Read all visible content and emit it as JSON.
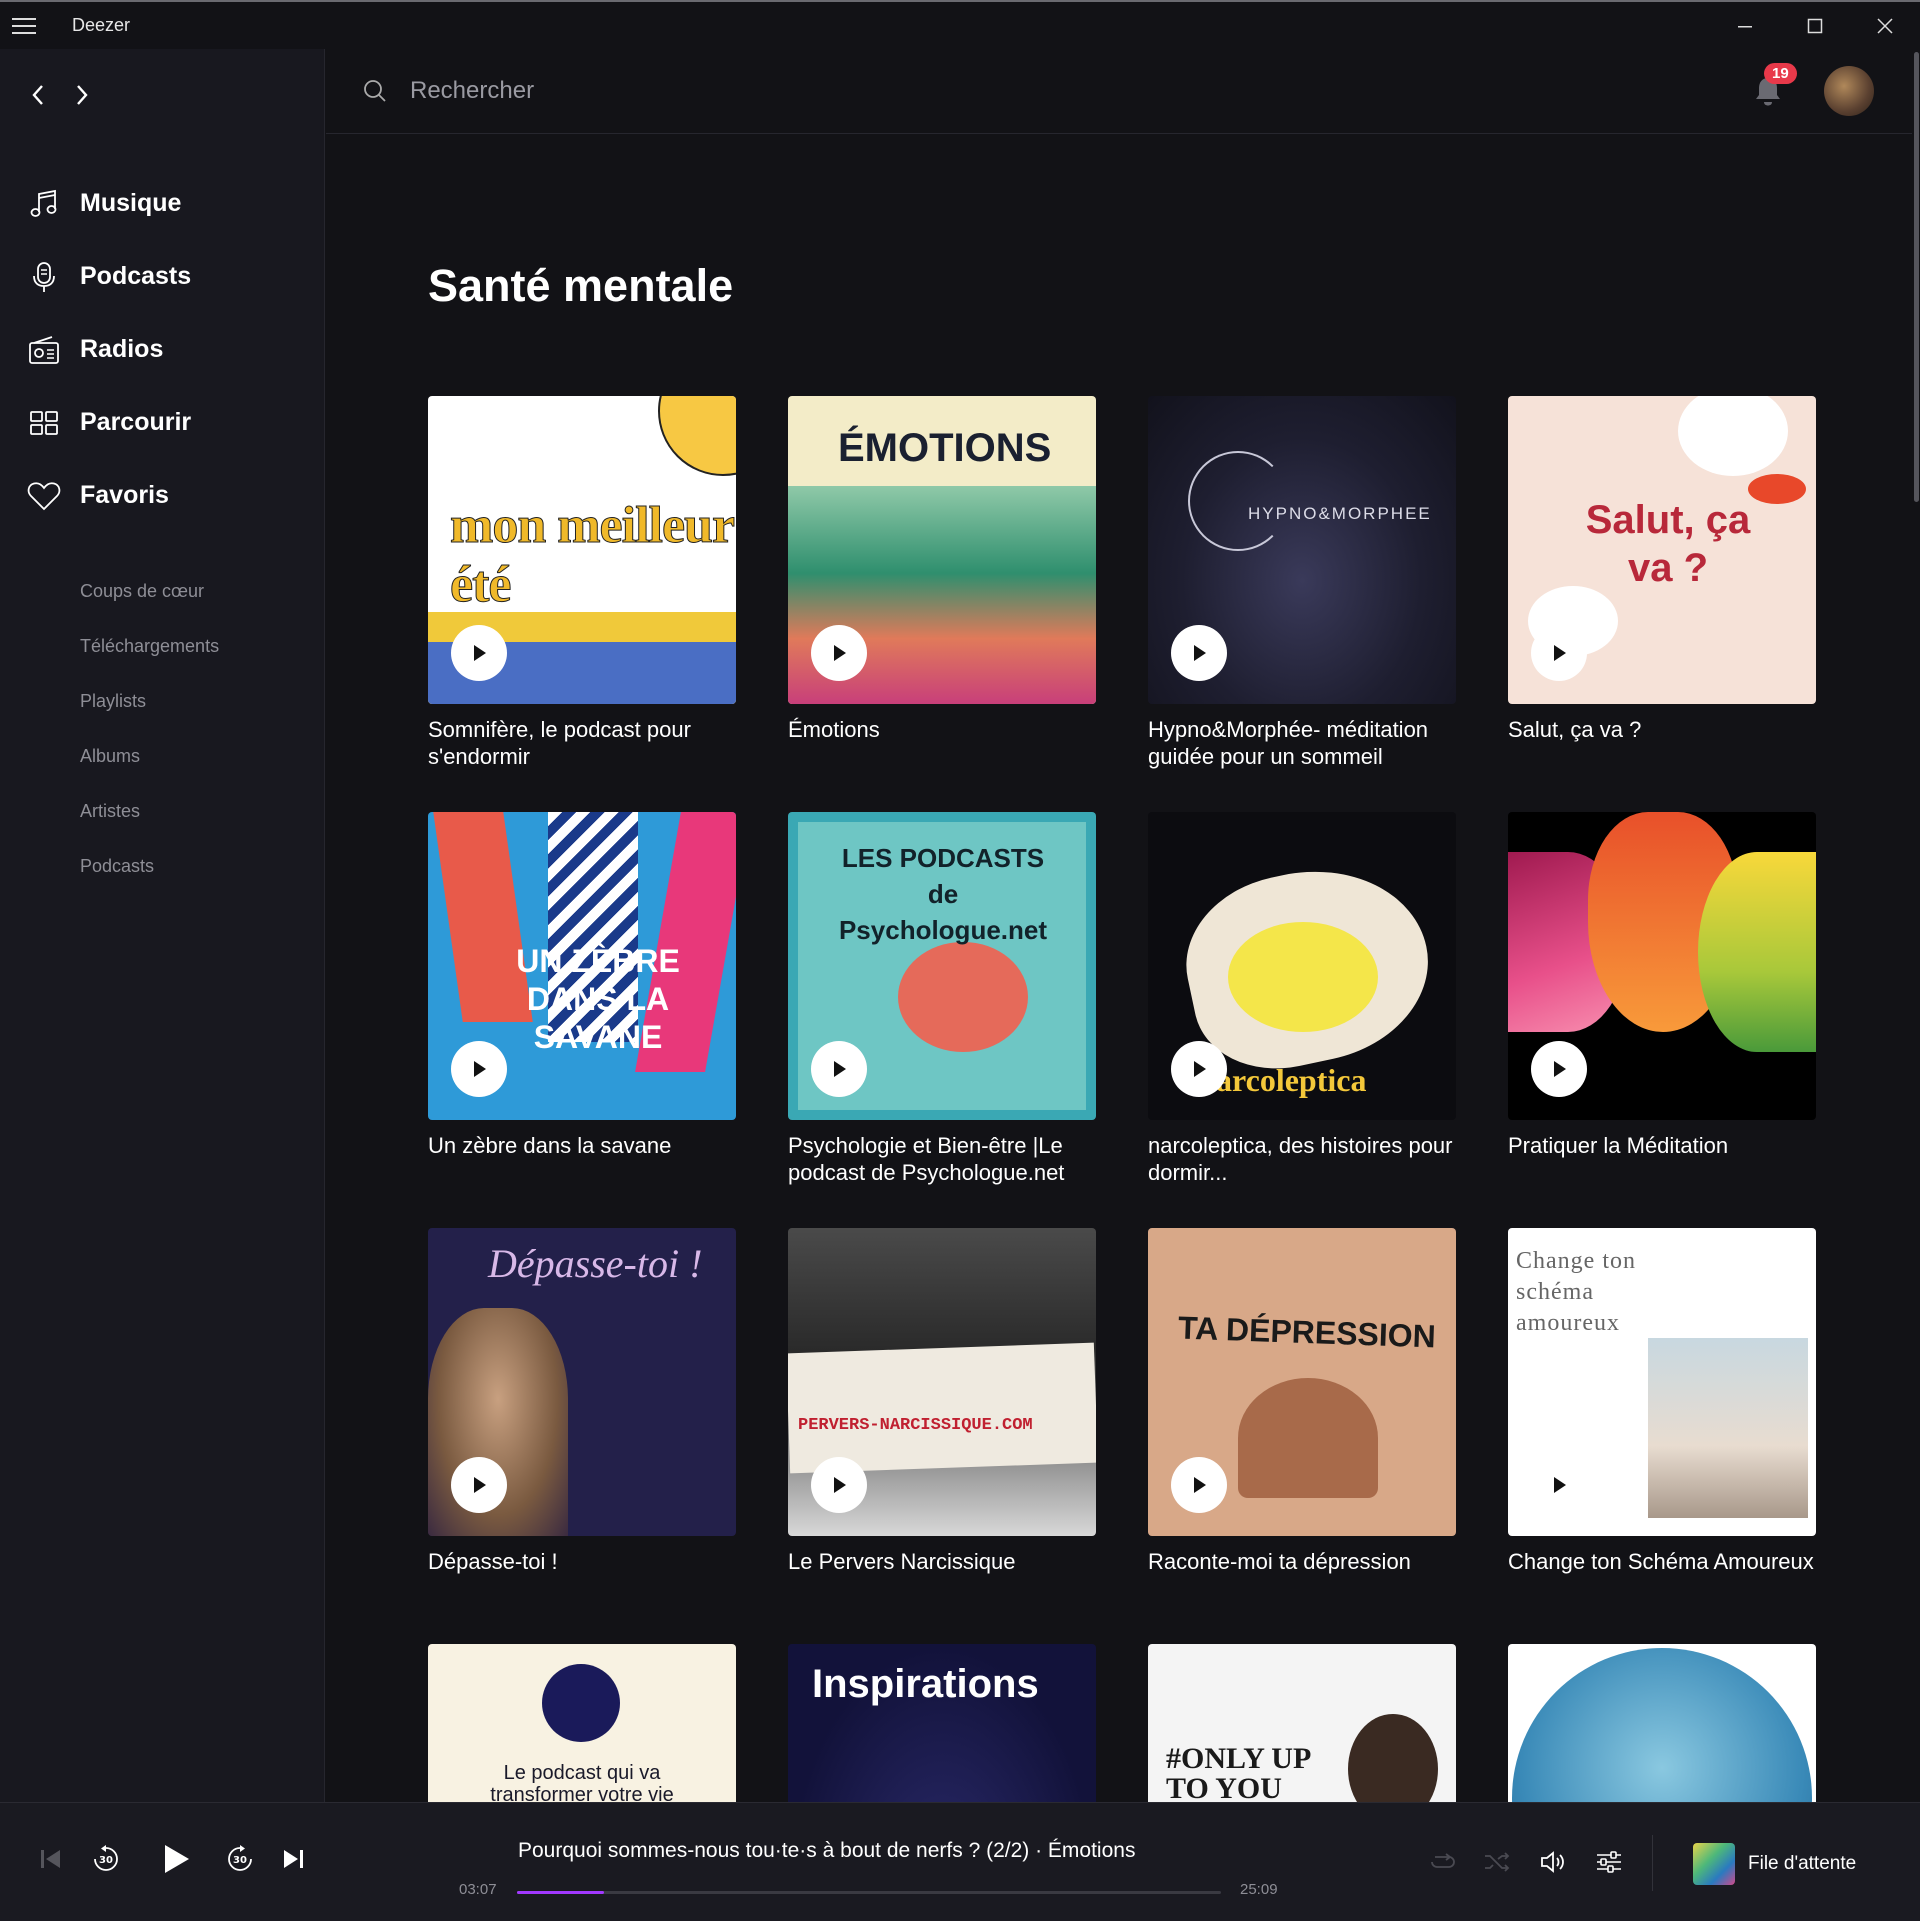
{
  "window": {
    "title": "Deezer"
  },
  "search": {
    "placeholder": "Rechercher"
  },
  "notifications": {
    "count": "19"
  },
  "sidebar": {
    "main": [
      {
        "label": "Musique",
        "icon": "music-note-icon"
      },
      {
        "label": "Podcasts",
        "icon": "microphone-icon"
      },
      {
        "label": "Radios",
        "icon": "radio-icon"
      },
      {
        "label": "Parcourir",
        "icon": "grid-icon"
      },
      {
        "label": "Favoris",
        "icon": "heart-icon"
      }
    ],
    "sub": [
      {
        "label": "Coups de cœur"
      },
      {
        "label": "Téléchargements"
      },
      {
        "label": "Playlists"
      },
      {
        "label": "Albums"
      },
      {
        "label": "Artistes"
      },
      {
        "label": "Podcasts"
      }
    ]
  },
  "page": {
    "title": "Santé mentale"
  },
  "cards": [
    {
      "title": "Somnifère, le podcast pour s'endormir",
      "cover_text": "mon meilleur été"
    },
    {
      "title": "Émotions",
      "cover_text": "ÉMOTIONS"
    },
    {
      "title": "Hypno&Morphée- méditation guidée pour un sommeil",
      "cover_text": "HYPNO&MORPHEE"
    },
    {
      "title": "Salut, ça va ?",
      "cover_text": "Salut, ça va ?"
    },
    {
      "title": "Un zèbre dans la savane",
      "cover_text": "UN ZÈBRE DANS LA SAVANE"
    },
    {
      "title": "Psychologie et Bien-être |Le podcast de Psychologue.net",
      "cover_text": "LES PODCASTS de Psychologue.net"
    },
    {
      "title": "narcoleptica, des histoires pour dormir...",
      "cover_text": "arcoleptica"
    },
    {
      "title": "Pratiquer la Méditation",
      "cover_text": ""
    },
    {
      "title": "Dépasse-toi !",
      "cover_text": "Dépasse-toi !"
    },
    {
      "title": "Le Pervers Narcissique",
      "cover_text": "PERVERS-NARCISSIQUE.COM"
    },
    {
      "title": "Raconte-moi ta dépression",
      "cover_text": "TA DÉPRESSION"
    },
    {
      "title": "Change ton Schéma Amoureux",
      "cover_text": "Change ton schéma amoureux"
    },
    {
      "title": "",
      "cover_text": "Le podcast qui va transformer votre vie"
    },
    {
      "title": "",
      "cover_text": "Inspirations"
    },
    {
      "title": "",
      "cover_text": "#ONLY UP TO YOU"
    },
    {
      "title": "",
      "cover_text": ""
    }
  ],
  "player": {
    "track": "Pourquoi sommes-nous tou·te·s à bout de nerfs ? (2/2) · Émotions",
    "current_time": "03:07",
    "total_time": "25:09",
    "progress": 0.124,
    "queue_label": "File d'attente"
  },
  "colors": {
    "accent": "#a238ff",
    "badge": "#e8394a",
    "background": "#121216",
    "sidebar": "#18181f"
  }
}
